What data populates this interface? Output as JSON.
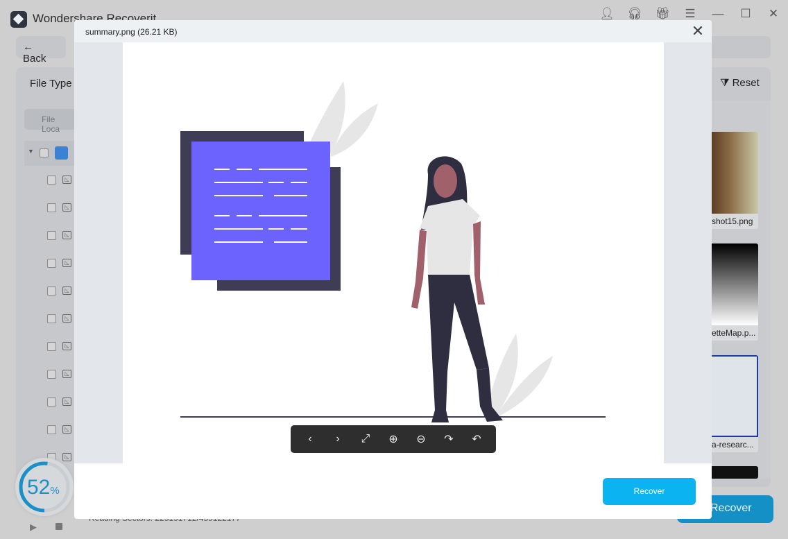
{
  "app": {
    "title": "Wondershare Recoverit",
    "back_label": "Back",
    "file_type_label": "File Type",
    "reset_label": "Reset",
    "file_location_label": "File Loca",
    "recover_label": "Recover",
    "progress_percent": 52,
    "progress_text": "52",
    "percent_sign": "%",
    "status_text": "Reading Sectors: 225191712/459122177"
  },
  "window_icons": [
    "user-icon",
    "headset-icon",
    "gift-icon",
    "menu-icon",
    "minimize-icon",
    "maximize-icon",
    "close-icon"
  ],
  "thumbnails": [
    {
      "label": "shot15.png"
    },
    {
      "label": "etteMap.p..."
    },
    {
      "label": "a-researc..."
    }
  ],
  "tree_rows": 11,
  "preview": {
    "title": "summary.png (26.21 KB)",
    "recover_label": "Recover",
    "toolbar": [
      "previous-icon",
      "next-icon",
      "fullscreen-icon",
      "zoom-in-icon",
      "zoom-out-icon",
      "rotate-right-icon",
      "rotate-left-icon"
    ]
  },
  "colors": {
    "accent": "#0bb3f0",
    "illustration_purple": "#6c63ff",
    "illustration_dark": "#3f3d56"
  }
}
